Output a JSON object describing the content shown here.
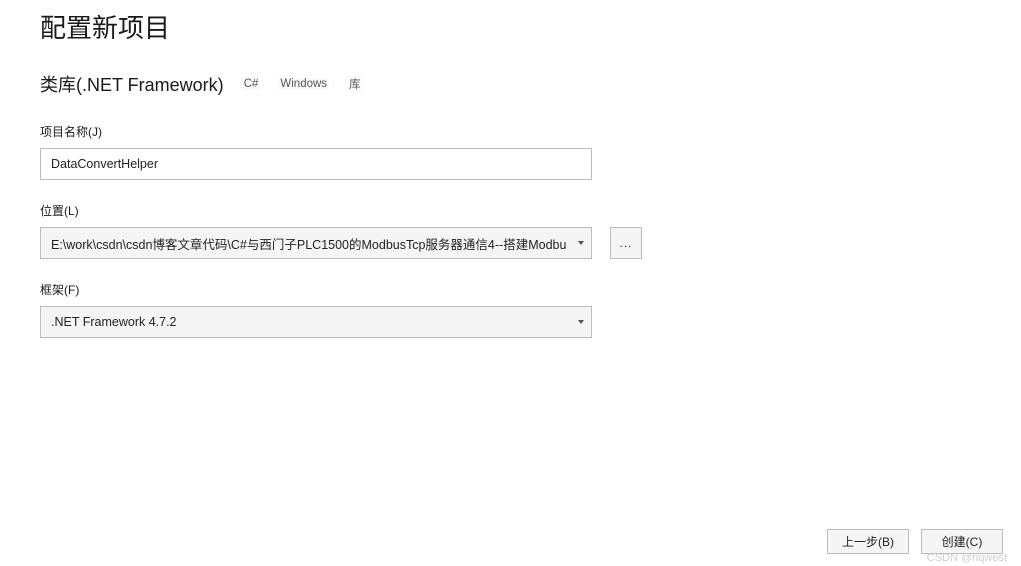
{
  "page_title": "配置新项目",
  "subtitle": "类库(.NET Framework)",
  "tags": [
    "C#",
    "Windows",
    "库"
  ],
  "fields": {
    "project_name": {
      "label": "项目名称(J)",
      "value": "DataConvertHelper"
    },
    "location": {
      "label": "位置(L)",
      "value": "E:\\work\\csdn\\csdn博客文章代码\\C#与西门子PLC1500的ModbusTcp服务器通信4--搭建Modbu",
      "browse_label": "..."
    },
    "framework": {
      "label": "框架(F)",
      "value": ".NET Framework 4.7.2"
    }
  },
  "footer": {
    "back_label": "上一步(B)",
    "create_label": "创建(C)"
  },
  "watermark": "CSDN @hqwest"
}
